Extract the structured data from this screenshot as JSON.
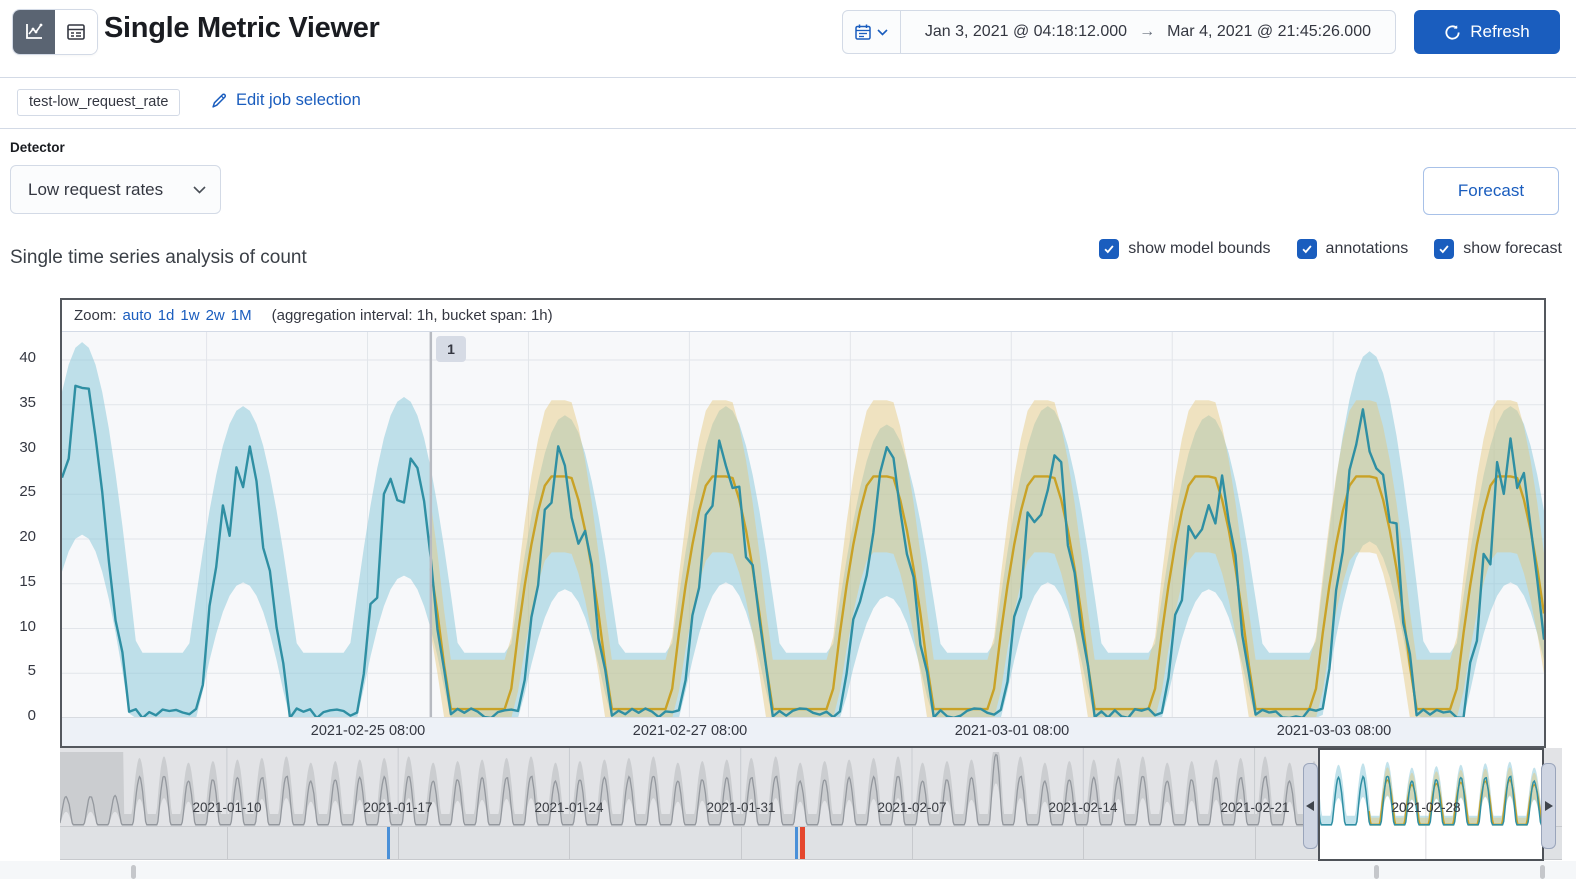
{
  "header": {
    "title": "Single Metric Viewer",
    "time_start": "Jan 3, 2021 @ 04:18:12.000",
    "time_arrow": "→",
    "time_end": "Mar 4, 2021 @ 21:45:26.000",
    "refresh_label": "Refresh"
  },
  "job": {
    "badge": "test-low_request_rate",
    "edit_label": "Edit job selection"
  },
  "detector": {
    "label": "Detector",
    "value": "Low request rates"
  },
  "forecast_label": "Forecast",
  "analysis_heading": "Single time series analysis of count",
  "toggles": {
    "model_bounds": "show model bounds",
    "annotations": "annotations",
    "forecast": "show forecast"
  },
  "chart_data": {
    "type": "line",
    "title": "Single time series analysis of count",
    "zoom_bar": {
      "label": "Zoom:",
      "links": [
        "auto",
        "1d",
        "1w",
        "2w",
        "1M"
      ],
      "meta": "(aggregation interval: 1h, bucket span: 1h)"
    },
    "main_chart": {
      "ylim": [
        0,
        43
      ],
      "yticks": [
        0,
        5,
        10,
        15,
        20,
        25,
        30,
        35,
        40
      ],
      "xticks": [
        {
          "label": "2021-02-25 08:00",
          "frac": 0.206
        },
        {
          "label": "2021-02-27 08:00",
          "frac": 0.4226
        },
        {
          "label": "2021-03-01 08:00",
          "frac": 0.6393
        },
        {
          "label": "2021-03-03 08:00",
          "frac": 0.856
        }
      ],
      "hours": 221,
      "day_peak_hours": [
        3,
        27,
        51,
        75,
        99,
        123,
        147,
        171,
        195,
        216
      ],
      "actual_peaks": [
        35,
        28,
        29,
        27,
        28,
        26,
        28,
        27,
        34,
        28
      ],
      "trough": 1,
      "forecast_peak": 27,
      "forecast_start_hour": 55,
      "annotation": {
        "label": "1",
        "hour": 55
      },
      "noise": [
        0.4,
        -1.1,
        1.3,
        -0.5,
        0.9,
        -1.4,
        0.2,
        1.1,
        -0.8,
        1.4,
        -0.3,
        0.7,
        -1.2,
        0.5,
        1.0,
        -0.6,
        1.2,
        -1.0,
        0.3,
        0.8,
        -1.3,
        0.6,
        -0.2,
        1.4
      ]
    },
    "context_chart": {
      "days": 60.73,
      "xticks": [
        {
          "label": "2021-01-10",
          "day": 6.82
        },
        {
          "label": "2021-01-17",
          "day": 13.82
        },
        {
          "label": "2021-01-24",
          "day": 20.82
        },
        {
          "label": "2021-01-31",
          "day": 27.82
        },
        {
          "label": "2021-02-07",
          "day": 34.82
        },
        {
          "label": "2021-02-14",
          "day": 41.82
        },
        {
          "label": "2021-02-21",
          "day": 48.82
        },
        {
          "label": "2021-02-28",
          "day": 55.82
        }
      ],
      "peak": 30,
      "spike_k": 38,
      "spike_peak": 44,
      "clip_until_day": 2.6,
      "brush": {
        "start_day": 51.27,
        "end_day": 60.48,
        "label_inside": "2021-02-28",
        "label_inside_day": 55.82
      },
      "forecast_start_day": 53.54,
      "anomaly_markers": [
        {
          "day": 13.35,
          "color": "#4a90d8",
          "width": 3
        },
        {
          "day": 30.05,
          "color": "#4a90d8",
          "width": 3
        },
        {
          "day": 30.25,
          "color": "#e5472d",
          "width": 5
        }
      ],
      "annotation_marker_days": [
        2.98,
        53.8,
        60.58
      ]
    },
    "colors": {
      "actual_line": "#2f8fa3",
      "model_bounds": "rgba(134,197,215,0.5)",
      "forecast_line": "#c9a227",
      "forecast_bounds": "rgba(228,199,123,0.45)",
      "nav_line": "#94989e",
      "nav_band": "#cbcdd0",
      "grid": "#e2e5ea",
      "annotation_line": "#b7bac1"
    }
  }
}
